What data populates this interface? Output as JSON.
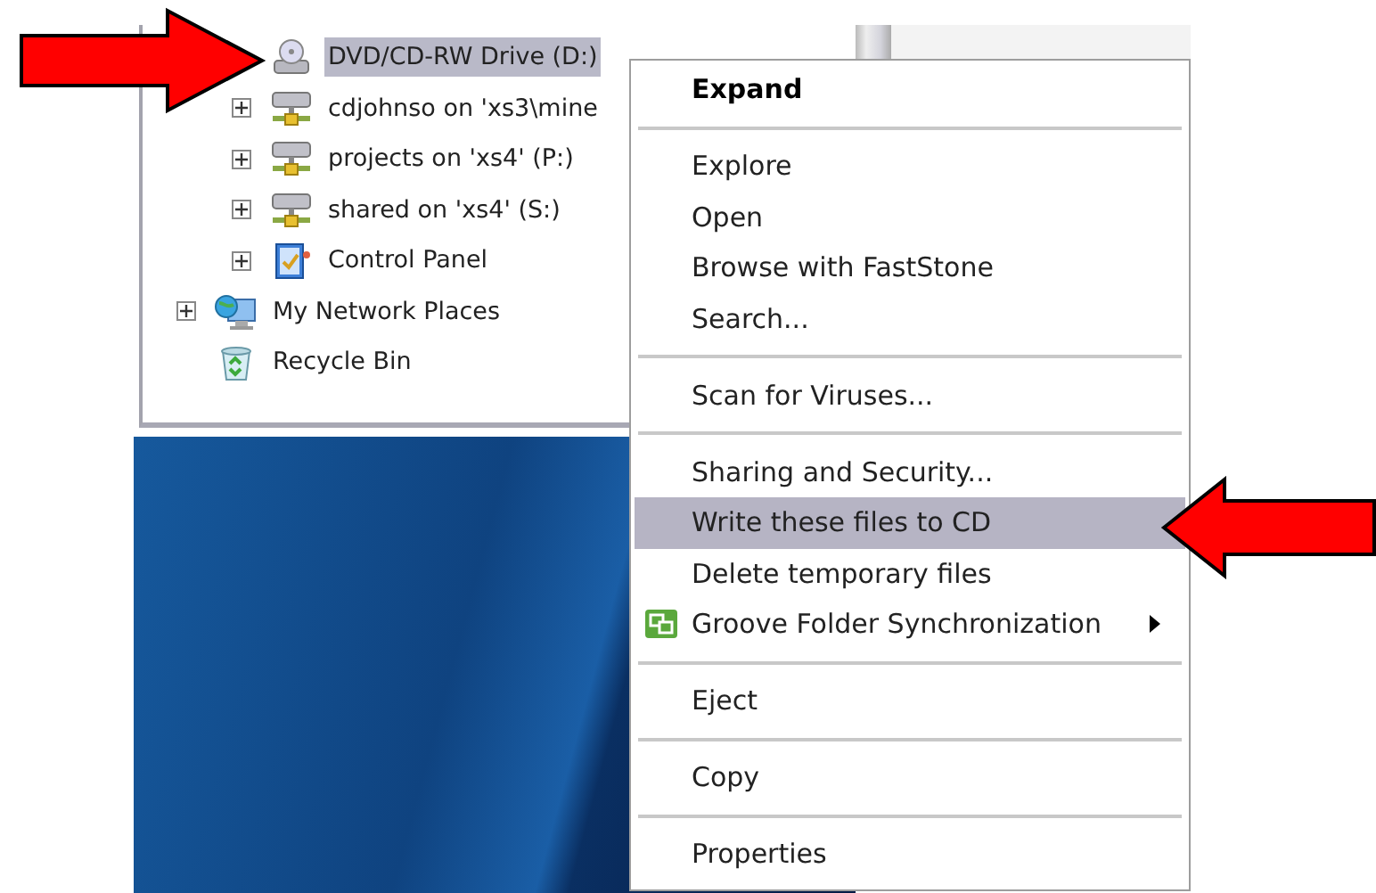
{
  "tree": [
    {
      "children": [
        {
          "kind": "cd-drive",
          "label": "DVD/CD-RW Drive (D:)",
          "expandable": false,
          "selected": true
        },
        {
          "kind": "network-drive",
          "label": "cdjohnso on 'xs3\\mine",
          "expandable": true,
          "selected": false
        },
        {
          "kind": "network-drive",
          "label": "projects on 'xs4' (P:)",
          "expandable": true,
          "selected": false
        },
        {
          "kind": "network-drive",
          "label": "shared on 'xs4' (S:)",
          "expandable": true,
          "selected": false
        },
        {
          "kind": "control-panel",
          "label": "Control Panel",
          "expandable": true,
          "selected": false
        }
      ]
    },
    {
      "kind": "network-places",
      "label": "My Network Places",
      "expandable": true,
      "selected": false
    },
    {
      "kind": "recycle-bin",
      "label": "Recycle Bin",
      "expandable": false,
      "selected": false
    }
  ],
  "context_menu": {
    "items": [
      {
        "kind": "item",
        "label": "Expand",
        "default": true,
        "selected": false,
        "submenu": false
      },
      {
        "kind": "separator"
      },
      {
        "kind": "item",
        "label": "Explore",
        "default": false,
        "selected": false,
        "submenu": false
      },
      {
        "kind": "item",
        "label": "Open",
        "default": false,
        "selected": false,
        "submenu": false
      },
      {
        "kind": "item",
        "label": "Browse with FastStone",
        "default": false,
        "selected": false,
        "submenu": false
      },
      {
        "kind": "item",
        "label": "Search...",
        "default": false,
        "selected": false,
        "submenu": false
      },
      {
        "kind": "separator"
      },
      {
        "kind": "item",
        "label": "Scan for Viruses...",
        "default": false,
        "selected": false,
        "submenu": false
      },
      {
        "kind": "separator"
      },
      {
        "kind": "item",
        "label": "Sharing and Security...",
        "default": false,
        "selected": false,
        "submenu": false
      },
      {
        "kind": "item",
        "label": "Write these files to CD",
        "default": false,
        "selected": true,
        "submenu": false
      },
      {
        "kind": "item",
        "label": "Delete temporary files",
        "default": false,
        "selected": false,
        "submenu": false
      },
      {
        "kind": "icon-item",
        "label": "Groove Folder Synchronization",
        "default": false,
        "selected": false,
        "submenu": true
      },
      {
        "kind": "separator"
      },
      {
        "kind": "item",
        "label": "Eject",
        "default": false,
        "selected": false,
        "submenu": false
      },
      {
        "kind": "separator"
      },
      {
        "kind": "item",
        "label": "Copy",
        "default": false,
        "selected": false,
        "submenu": false
      },
      {
        "kind": "separator"
      },
      {
        "kind": "item",
        "label": "Properties",
        "default": false,
        "selected": false,
        "submenu": false
      }
    ]
  }
}
